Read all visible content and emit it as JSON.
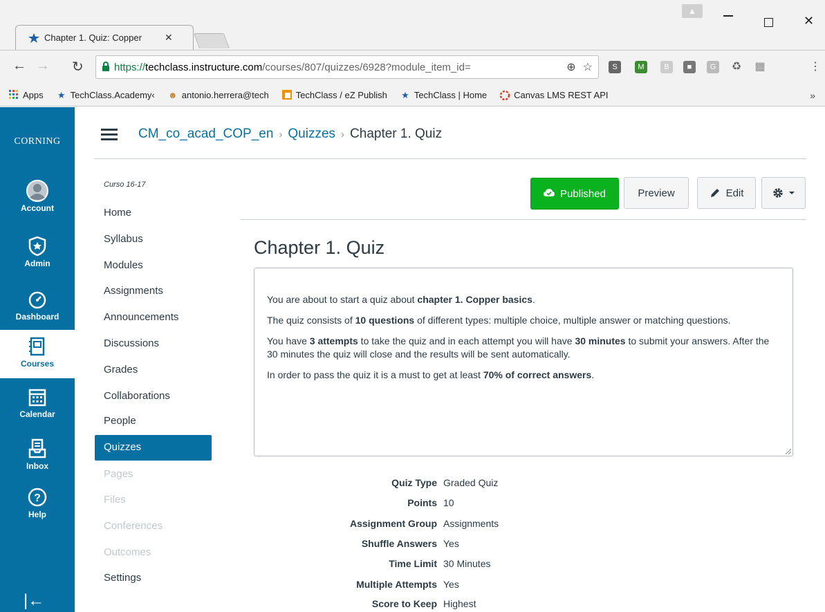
{
  "browser": {
    "tab_title": "Chapter 1. Quiz: Copper",
    "url_scheme": "https://",
    "url_host": "techclass.instructure.com",
    "url_path": "/courses/807/quizzes/6928?module_item_id=",
    "bookmarks": [
      {
        "label": "Apps",
        "icon": "apps-grid-icon"
      },
      {
        "label": "TechClass.Academy‹",
        "icon": "techclass-star-icon"
      },
      {
        "label": "antonio.herrera@tech",
        "icon": "person-icon"
      },
      {
        "label": "TechClass / eZ Publish",
        "icon": "ez-publish-icon"
      },
      {
        "label": "TechClass | Home",
        "icon": "techclass-star-icon"
      },
      {
        "label": "Canvas LMS REST API",
        "icon": "canvas-icon"
      }
    ],
    "more": "»"
  },
  "global_nav": {
    "brand": "CORNING",
    "items": [
      {
        "label": "Account",
        "icon": "account-icon"
      },
      {
        "label": "Admin",
        "icon": "admin-shield-icon"
      },
      {
        "label": "Dashboard",
        "icon": "dashboard-icon"
      },
      {
        "label": "Courses",
        "icon": "courses-icon"
      },
      {
        "label": "Calendar",
        "icon": "calendar-icon"
      },
      {
        "label": "Inbox",
        "icon": "inbox-icon"
      },
      {
        "label": "Help",
        "icon": "help-icon"
      }
    ],
    "collapse": "|←"
  },
  "breadcrumb": {
    "course": "CM_co_acad_COP_en",
    "section": "Quizzes",
    "current": "Chapter 1. Quiz",
    "separator": "›"
  },
  "course_nav": {
    "term": "Curso 16-17",
    "items": [
      {
        "label": "Home"
      },
      {
        "label": "Syllabus"
      },
      {
        "label": "Modules"
      },
      {
        "label": "Assignments"
      },
      {
        "label": "Announcements"
      },
      {
        "label": "Discussions"
      },
      {
        "label": "Grades"
      },
      {
        "label": "Collaborations"
      },
      {
        "label": "People"
      },
      {
        "label": "Quizzes"
      },
      {
        "label": "Pages"
      },
      {
        "label": "Files"
      },
      {
        "label": "Conferences"
      },
      {
        "label": "Outcomes"
      },
      {
        "label": "Settings"
      }
    ]
  },
  "actions": {
    "published": "Published",
    "preview": "Preview",
    "edit": "Edit"
  },
  "quiz": {
    "title": "Chapter 1. Quiz",
    "description": {
      "p1_a": "You are about to start a quiz about ",
      "p1_b": "chapter 1. Copper basics",
      "p1_c": ".",
      "p2_a": "The quiz consists of ",
      "p2_b": "10 questions",
      "p2_c": " of different types: multiple choice, multiple answer or matching questions.",
      "p3_a": "You have ",
      "p3_b": "3 attempts",
      "p3_c": " to take the quiz and in each attempt you will have ",
      "p3_d": "30 minutes",
      "p3_e": " to submit your answers. After the 30 minutes the quiz will close and the results will be sent automatically.",
      "p4_a": "In order to pass the quiz it is a must to get at least ",
      "p4_b": "70% of correct answers",
      "p4_c": "."
    },
    "details": [
      {
        "label": "Quiz Type",
        "value": "Graded Quiz"
      },
      {
        "label": "Points",
        "value": "10"
      },
      {
        "label": "Assignment Group",
        "value": "Assignments"
      },
      {
        "label": "Shuffle Answers",
        "value": "Yes"
      },
      {
        "label": "Time Limit",
        "value": "30 Minutes"
      },
      {
        "label": "Multiple Attempts",
        "value": "Yes"
      },
      {
        "label": "Score to Keep",
        "value": "Highest"
      }
    ]
  },
  "colors": {
    "canvas_blue": "#0770a3",
    "published_green": "#0ab21f",
    "text": "#2d3b45"
  }
}
